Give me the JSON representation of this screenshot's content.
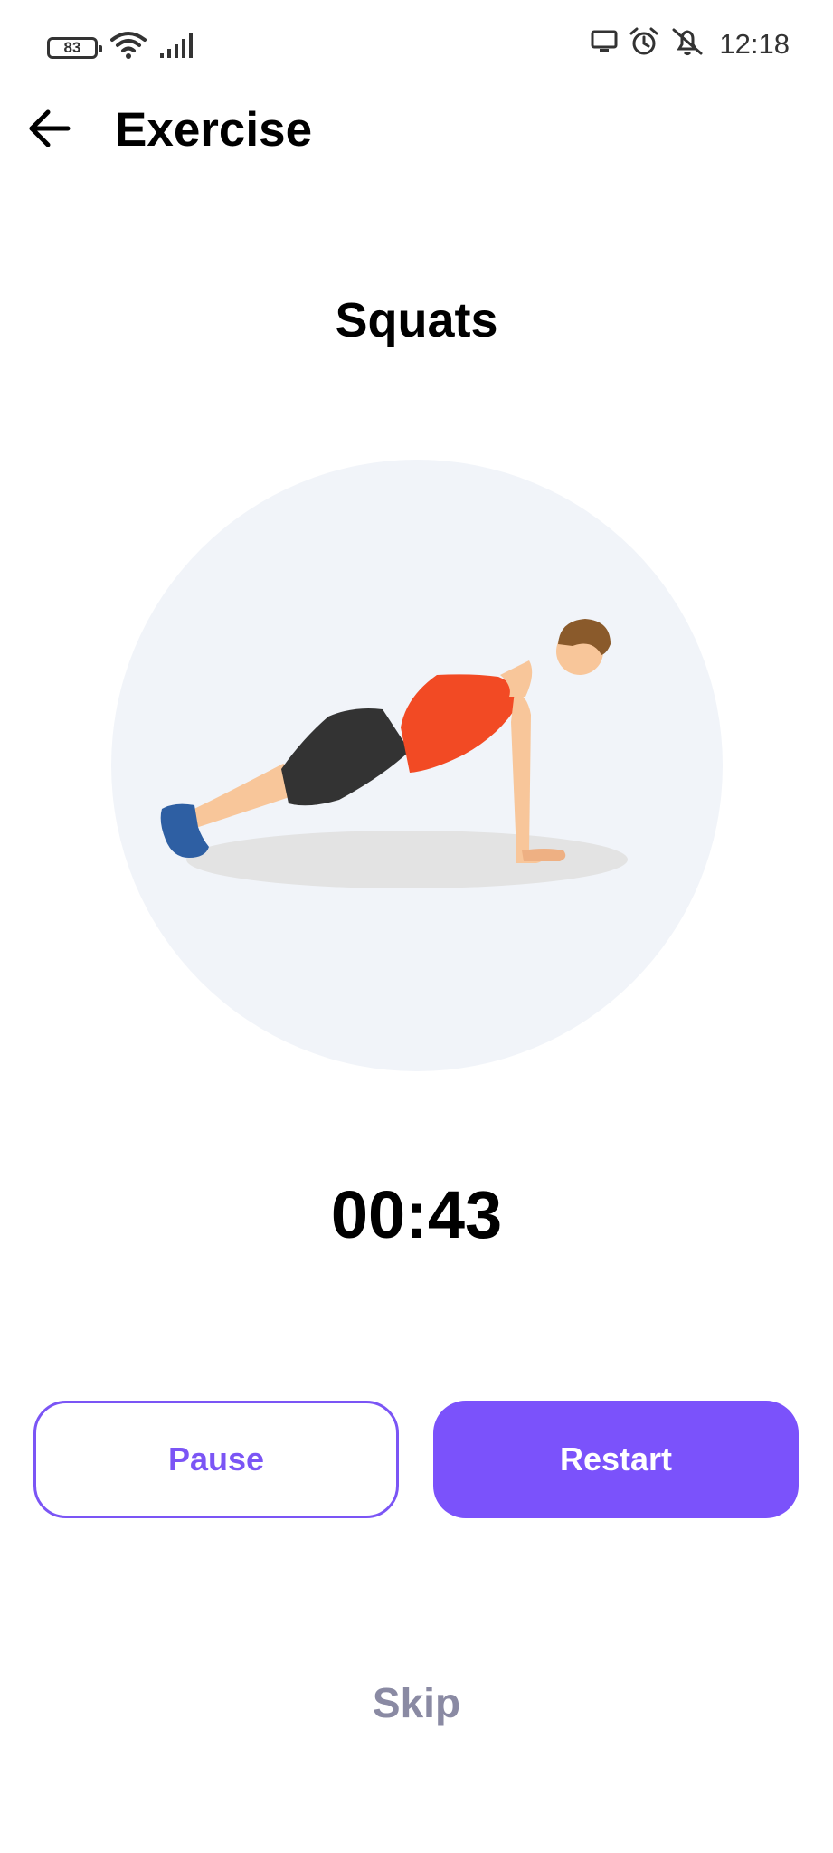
{
  "status_bar": {
    "battery": "83",
    "time": "12:18",
    "icons": [
      "battery-icon",
      "wifi-icon",
      "signal-icon",
      "cast-icon",
      "alarm-icon",
      "mute-icon"
    ]
  },
  "header": {
    "back_icon": "arrow-left-icon",
    "title": "Exercise"
  },
  "exercise": {
    "name": "Squats",
    "illustration": "push-up-figure"
  },
  "timer": {
    "value": "00:43"
  },
  "buttons": {
    "pause_label": "Pause",
    "restart_label": "Restart",
    "skip_label": "Skip"
  },
  "colors": {
    "accent": "#7b52fb",
    "skip": "#8a8aa3",
    "illustration_bg": "#f1f4f9"
  }
}
